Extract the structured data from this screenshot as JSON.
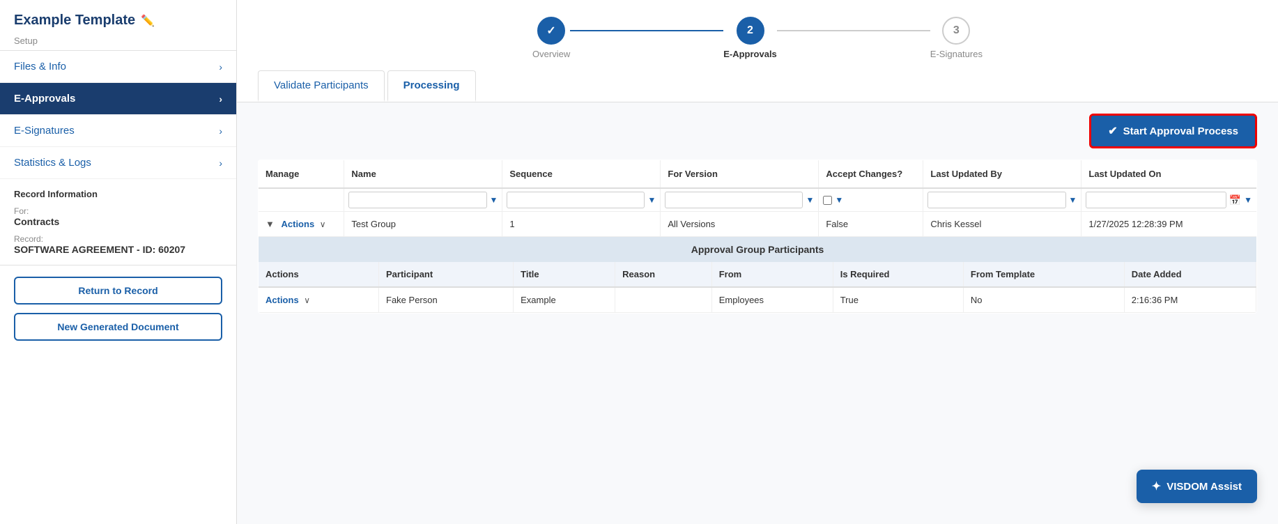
{
  "sidebar": {
    "title": "Example Template",
    "setup_label": "Setup",
    "items": [
      {
        "id": "files-info",
        "label": "Files & Info",
        "active": false
      },
      {
        "id": "e-approvals",
        "label": "E-Approvals",
        "active": true
      },
      {
        "id": "e-signatures",
        "label": "E-Signatures",
        "active": false
      },
      {
        "id": "statistics-logs",
        "label": "Statistics & Logs",
        "active": false
      }
    ],
    "record_info": {
      "for_label": "For:",
      "for_value": "Contracts",
      "record_label": "Record:",
      "record_value": "SOFTWARE AGREEMENT - ID: 60207"
    },
    "buttons": [
      {
        "id": "return-to-record",
        "label": "Return to Record"
      },
      {
        "id": "new-generated-document",
        "label": "New Generated Document"
      }
    ]
  },
  "stepper": {
    "steps": [
      {
        "id": "overview",
        "number": "✓",
        "label": "Overview",
        "state": "completed"
      },
      {
        "id": "e-approvals",
        "number": "2",
        "label": "E-Approvals",
        "state": "active"
      },
      {
        "id": "e-signatures",
        "number": "3",
        "label": "E-Signatures",
        "state": "inactive"
      }
    ]
  },
  "tabs": [
    {
      "id": "validate-participants",
      "label": "Validate Participants",
      "active": false
    },
    {
      "id": "processing",
      "label": "Processing",
      "active": true
    }
  ],
  "start_approval_btn": "Start Approval Process",
  "table": {
    "columns": [
      "Manage",
      "Name",
      "Sequence",
      "For Version",
      "Accept Changes?",
      "Last Updated By",
      "Last Updated On"
    ],
    "rows": [
      {
        "manage": "Actions",
        "name": "Test Group",
        "sequence": "1",
        "for_version": "All Versions",
        "accept_changes": "False",
        "last_updated_by": "Chris Kessel",
        "last_updated_on": "1/27/2025 12:28:39 PM"
      }
    ]
  },
  "sub_table": {
    "header": "Approval Group Participants",
    "columns": [
      "Actions",
      "Participant",
      "Title",
      "Reason",
      "From",
      "Is Required",
      "From Template",
      "Date Added"
    ],
    "rows": [
      {
        "actions": "Actions",
        "participant": "Fake Person",
        "title": "Example",
        "reason": "",
        "from": "Employees",
        "is_required": "True",
        "from_template": "No",
        "date_added": "2:16:36 PM"
      }
    ]
  },
  "visdom_assist_label": "VISDOM Assist",
  "icons": {
    "edit": "✏️",
    "check": "✓",
    "chevron_right": "›",
    "chevron_down": "∨",
    "filter": "▼",
    "calendar": "📅",
    "sparkle": "✦",
    "circle_check": "✔"
  }
}
